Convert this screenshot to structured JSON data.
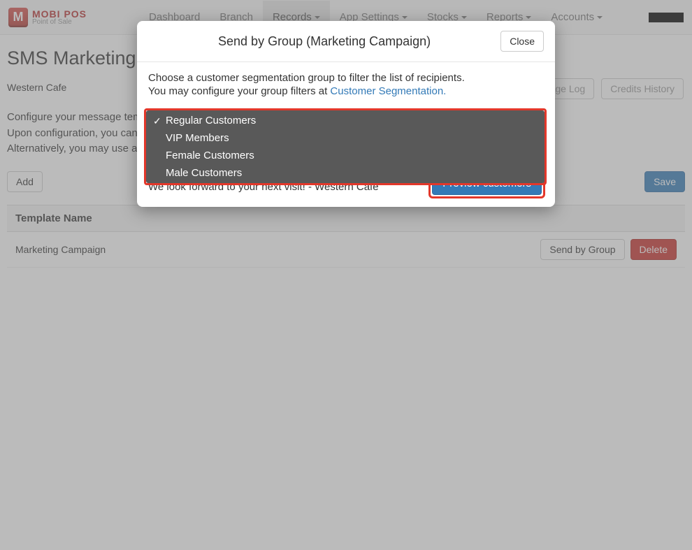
{
  "brand": {
    "badge": "M",
    "title": "MOBI POS",
    "subtitle": "Point of Sale"
  },
  "nav": {
    "items": [
      {
        "label": "Dashboard",
        "caret": false,
        "active": false
      },
      {
        "label": "Branch",
        "caret": false,
        "active": false
      },
      {
        "label": "Records",
        "caret": true,
        "active": true
      },
      {
        "label": "App Settings",
        "caret": true,
        "active": false
      },
      {
        "label": "Stocks",
        "caret": true,
        "active": false
      },
      {
        "label": "Reports",
        "caret": true,
        "active": false
      },
      {
        "label": "Accounts",
        "caret": true,
        "active": false
      }
    ]
  },
  "page": {
    "title": "SMS Marketing",
    "cafe": "Western Cafe",
    "intro1": "Configure your message templates to send to your customers.",
    "intro2": "Upon configuration, you can setup your campaign…",
    "intro3": "Alternatively, you may use an…",
    "top_buttons": {
      "usage_log": "Usage Log",
      "credits_history": "Credits History"
    },
    "add": "Add",
    "save": "Save",
    "section_header": "Template Name",
    "template_name": "Marketing Campaign",
    "row_actions": {
      "send_by_group": "Send by Group",
      "delete": "Delete"
    }
  },
  "modal": {
    "title": "Send by Group (Marketing Campaign)",
    "close": "Close",
    "line1": "Choose a customer segmentation group to filter the list of recipients.",
    "line2_prefix": "You may configure your group filters at ",
    "line2_link": "Customer Segmentation.",
    "msg": "We look forward to your next visit! - Western Cafe",
    "preview": "Preview customers",
    "dropdown": [
      {
        "label": "Regular Customers",
        "selected": true
      },
      {
        "label": "VIP Members",
        "selected": false
      },
      {
        "label": "Female Customers",
        "selected": false
      },
      {
        "label": "Male Customers",
        "selected": false
      }
    ]
  }
}
